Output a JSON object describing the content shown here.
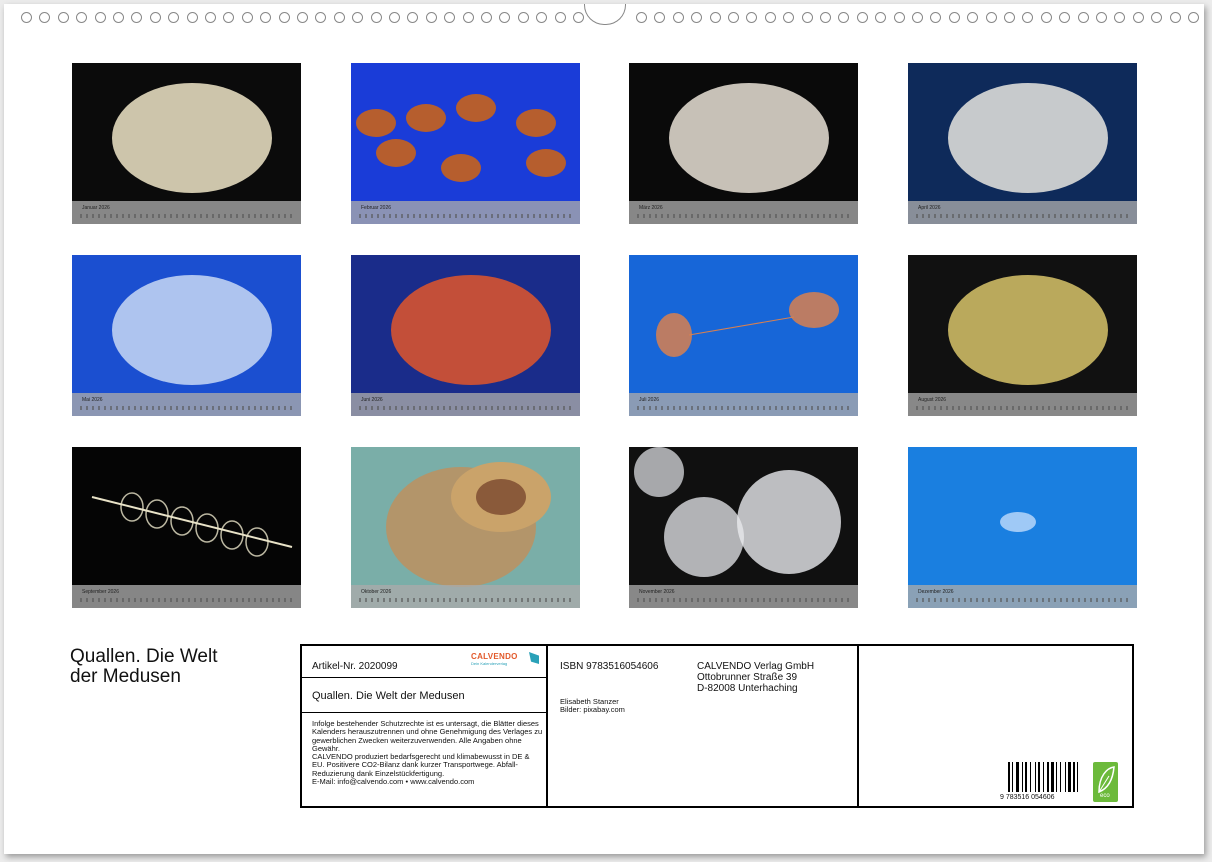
{
  "calendar": {
    "title": "Quallen. Die Welt der Medusen",
    "title_display": "Quallen. Die Welt\nder Medusen",
    "months": [
      {
        "label": "Januar 2026",
        "bg": "#0b0b0b",
        "accent": "#f0e6c8",
        "icon": "comb-jelly-icon"
      },
      {
        "label": "Februar 2026",
        "bg": "#1a3cd8",
        "accent": "#c8621c",
        "icon": "sea-nettle-icon"
      },
      {
        "label": "März 2026",
        "bg": "#0a0a0a",
        "accent": "#e9e2d6",
        "icon": "jellyfish-icon"
      },
      {
        "label": "April 2026",
        "bg": "#0e2a5a",
        "accent": "#e8e6e0",
        "icon": "spotted-jelly-icon"
      },
      {
        "label": "Mai 2026",
        "bg": "#1b4fd0",
        "accent": "#c8d8f4",
        "icon": "translucent-jelly-icon"
      },
      {
        "label": "Juni 2026",
        "bg": "#1a2c8a",
        "accent": "#e2562a",
        "icon": "sea-nettle-icon"
      },
      {
        "label": "Juli 2026",
        "bg": "#1766d8",
        "accent": "#d88050",
        "icon": "jellyfish-pair-icon"
      },
      {
        "label": "August 2026",
        "bg": "#111",
        "accent": "#d8c46a",
        "icon": "flower-hat-jelly-icon"
      },
      {
        "label": "September 2026",
        "bg": "#050505",
        "accent": "#e9e3c8",
        "icon": "siphonophore-icon"
      },
      {
        "label": "Oktober 2026",
        "bg": "#7aaea8",
        "accent": "#caa36a",
        "icon": "fried-egg-jelly-icon"
      },
      {
        "label": "November 2026",
        "bg": "#101010",
        "accent": "#e8eaee",
        "icon": "moon-jelly-icon"
      },
      {
        "label": "Dezember 2026",
        "bg": "#1a7fe0",
        "accent": "#d8e8ff",
        "icon": "moon-jelly-icon"
      }
    ]
  },
  "info": {
    "article": "Artikel-Nr. 2020099",
    "logo_name": "CALVENDO",
    "logo_sub": "Dein Kalenderverlag",
    "box_title": "Quallen. Die Welt der Medusen",
    "legal": "Infolge bestehender Schutzrechte ist es untersagt, die Blätter dieses Kalenders herauszutrennen und ohne Genehmigung des Verlages zu gewerblichen Zwecken weiterzuverwenden. Alle Angaben ohne Gewähr.\nCALVENDO produziert bedarfsgerecht und klimabewusst in DE & EU. Positivere CO2-Bilanz dank kurzer Transportwege. Abfall-Reduzierung dank Einzelstückfertigung.\nE-Mail: info@calvendo.com • www.calvendo.com",
    "isbn": "ISBN 9783516054606",
    "author": "Elisabeth Stanzer",
    "images": "Bilder: pixabay.com",
    "publisher_name": "CALVENDO Verlag GmbH",
    "publisher_street": "Ottobrunner Straße 39",
    "publisher_city": "D-82008 Unterhaching",
    "barcode_number": "9 783516 054606",
    "eco_label": "eco"
  }
}
